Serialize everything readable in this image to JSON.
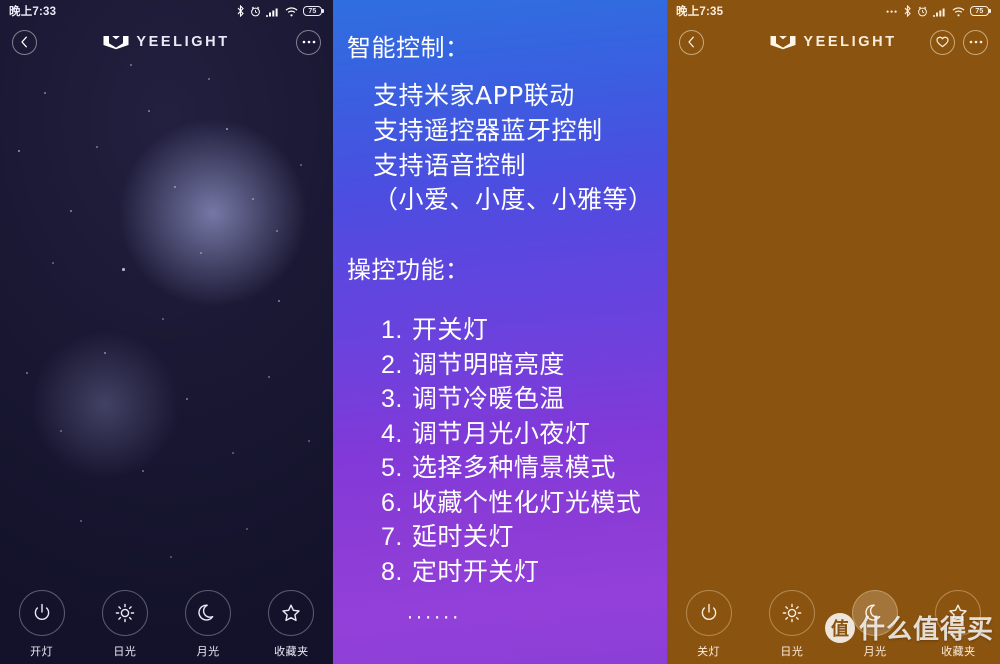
{
  "panels": {
    "left": {
      "status": {
        "time": "晚上7:33",
        "battery": "75",
        "icons": [
          "bluetooth-icon",
          "alarm-icon",
          "signal-icon",
          "wifi-icon",
          "battery-icon"
        ]
      },
      "appbar": {
        "back": "‹",
        "brand": "YEELIGHT",
        "more": "•••"
      },
      "tools": [
        {
          "label": "开灯",
          "icon": "power-icon",
          "selected": false
        },
        {
          "label": "日光",
          "icon": "sun-icon",
          "selected": false
        },
        {
          "label": "月光",
          "icon": "moon-icon",
          "selected": false
        },
        {
          "label": "收藏夹",
          "icon": "star-icon",
          "selected": false
        }
      ]
    },
    "middle": {
      "heading1": "智能控制：",
      "features": [
        "支持米家APP联动",
        "支持遥控器蓝牙控制",
        "支持语音控制",
        "（小爱、小度、小雅等）"
      ],
      "heading2": "操控功能：",
      "functions": [
        {
          "num": "1.",
          "text": "开关灯"
        },
        {
          "num": "2.",
          "text": "调节明暗亮度"
        },
        {
          "num": "3.",
          "text": "调节冷暖色温"
        },
        {
          "num": "4.",
          "text": "调节月光小夜灯"
        },
        {
          "num": "5.",
          "text": "选择多种情景模式"
        },
        {
          "num": "6.",
          "text": "收藏个性化灯光模式"
        },
        {
          "num": "7.",
          "text": "延时关灯"
        },
        {
          "num": "8.",
          "text": "定时开关灯"
        }
      ],
      "ellipsis": "······"
    },
    "right": {
      "status": {
        "time": "晚上7:35",
        "battery": "75",
        "icons": [
          "more-dots-icon",
          "bluetooth-icon",
          "alarm-icon",
          "signal-icon",
          "wifi-icon",
          "battery-icon"
        ]
      },
      "appbar": {
        "back": "‹",
        "brand": "YEELIGHT",
        "favorite": "♡",
        "more": "•••"
      },
      "tools": [
        {
          "label": "关灯",
          "icon": "power-icon",
          "selected": false
        },
        {
          "label": "日光",
          "icon": "sun-icon",
          "selected": false
        },
        {
          "label": "月光",
          "icon": "moon-icon",
          "selected": true
        },
        {
          "label": "收藏夹",
          "icon": "star-icon",
          "selected": false
        }
      ]
    }
  },
  "watermark": {
    "badge": "值",
    "text": "什么值得买"
  },
  "colors": {
    "dark_bg": "#14142b",
    "warm_bg": "#8a530f",
    "promo_top": "#2f6fe0",
    "promo_bottom": "#8b3fd6"
  }
}
